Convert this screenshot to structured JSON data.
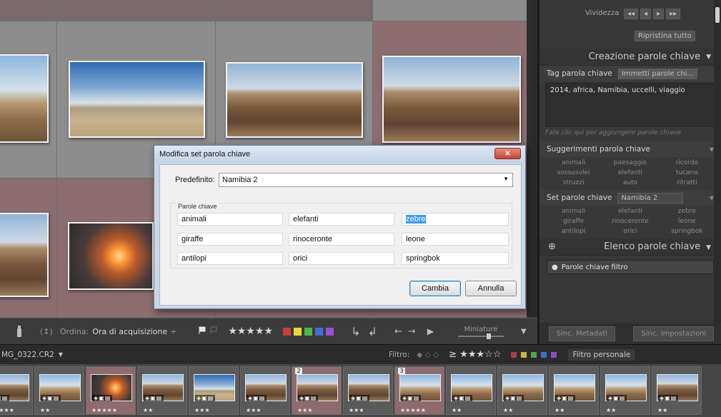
{
  "toolbar": {
    "sort_label": "Ordina:",
    "sort_value": "Ora di acquisizione",
    "sort_arrow": "÷",
    "stars": "★★★★★",
    "thumbnail_label": "Miniature",
    "swatch_colors": [
      "#d13b3b",
      "#e8d83a",
      "#4cb84c",
      "#3f6fd6",
      "#9a4fd6"
    ]
  },
  "panel": {
    "vividness_label": "Vividezza",
    "reset_all": "Ripristina tutto",
    "keywording_title": "Creazione parole chiave",
    "keyword_tags_label": "Tag parola chiave",
    "keyword_tags_mode": "Immetti parole chi...",
    "keyword_text": "2014, africa, Namibia, uccelli, viaggio",
    "add_keywords_hint": "Fate clic qui per aggiungere parole chiave",
    "suggestions_label": "Suggerimenti parola chiave",
    "suggestions": [
      "animali",
      "paesaggio",
      "ricordo",
      "sossusvlei",
      "elefanti",
      "tucano",
      "struzzi",
      "auto",
      "ritratti"
    ],
    "keyword_set_label": "Set parole chiave",
    "keyword_set_value": "Namibia 2",
    "keyword_set_items": [
      "animali",
      "elefanti",
      "zebre",
      "giraffe",
      "rinoceronte",
      "leone",
      "antilopi",
      "orici",
      "springbok"
    ],
    "keyword_list_title": "Elenco parole chiave",
    "filter_keywords": "Parole chiave filtro",
    "sync_metadata": "Sinc. Metadati",
    "sync_settings": "Sinc. Impostazioni"
  },
  "status": {
    "filename": "MG_0322.CR2",
    "filter_label": "Filtro:",
    "rating_filter": "≥ ★★★☆☆",
    "custom_filter": "Filtro personale"
  },
  "dialog": {
    "title": "Modifica set parola chiave",
    "preset_label": "Predefinito:",
    "preset_value": "Namibia 2",
    "group_label": "Parole chiave",
    "keywords": [
      "animali",
      "elefanti",
      "zebre",
      "giraffe",
      "rinoceronte",
      "leone",
      "antilopi",
      "orici",
      "springbok"
    ],
    "change_button": "Cambia",
    "cancel_button": "Annulla",
    "close": "✕"
  },
  "filmstrip": [
    {
      "stars": "★★★★★",
      "num": "",
      "thumb": "ph-canyon",
      "sel": false
    },
    {
      "stars": "★★",
      "num": "",
      "thumb": "ph-desert",
      "sel": false
    },
    {
      "stars": "★★★★★",
      "num": "",
      "thumb": "ph-sunset",
      "sel": true
    },
    {
      "stars": "★★",
      "num": "",
      "thumb": "ph-canyon",
      "sel": false
    },
    {
      "stars": "★★★",
      "num": "",
      "thumb": "ph-road",
      "sel": false
    },
    {
      "stars": "★★★",
      "num": "",
      "thumb": "ph-canyon",
      "sel": false
    },
    {
      "stars": "★★★",
      "num": "2",
      "thumb": "ph-canyon",
      "sel": true
    },
    {
      "stars": "★★★",
      "num": "",
      "thumb": "ph-canyon",
      "sel": false
    },
    {
      "stars": "★★★★★",
      "num": "3",
      "thumb": "ph-desert",
      "sel": true
    },
    {
      "stars": "★★",
      "num": "",
      "thumb": "ph-desert",
      "sel": false
    },
    {
      "stars": "★★",
      "num": "",
      "thumb": "ph-desert",
      "sel": false
    },
    {
      "stars": "★★",
      "num": "",
      "thumb": "ph-desert",
      "sel": false
    },
    {
      "stars": "★★",
      "num": "",
      "thumb": "ph-desert",
      "sel": false
    },
    {
      "stars": "★★",
      "num": "",
      "thumb": "ph-canyon",
      "sel": false
    }
  ]
}
